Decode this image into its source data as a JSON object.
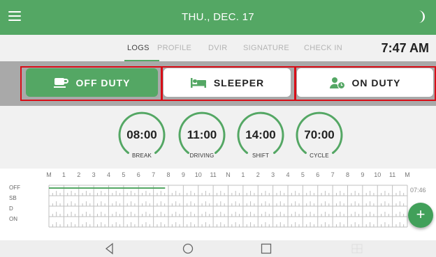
{
  "header": {
    "date": "THU., DEC. 17",
    "menu_icon": "hamburger-menu-icon",
    "theme_icon": "moon-icon"
  },
  "tabs": [
    {
      "label": "LOGS",
      "active": true
    },
    {
      "label": "PROFILE",
      "active": false
    },
    {
      "label": "DVIR",
      "active": false
    },
    {
      "label": "SIGNATURE",
      "active": false
    },
    {
      "label": "CHECK IN",
      "active": false
    }
  ],
  "clock": "7:47 AM",
  "duty_status": {
    "off_duty": {
      "label": "OFF DUTY",
      "icon": "coffee-cup-icon",
      "selected": true
    },
    "sleeper": {
      "label": "SLEEPER",
      "icon": "bed-icon",
      "selected": false
    },
    "on_duty": {
      "label": "ON DUTY",
      "icon": "driver-clock-icon",
      "selected": false
    }
  },
  "timers": [
    {
      "value": "08:00",
      "label": "BREAK"
    },
    {
      "value": "11:00",
      "label": "DRIVING"
    },
    {
      "value": "14:00",
      "label": "SHIFT"
    },
    {
      "value": "70:00",
      "label": "CYCLE"
    }
  ],
  "log_grid": {
    "hours": [
      "M",
      "1",
      "2",
      "3",
      "4",
      "5",
      "6",
      "7",
      "8",
      "9",
      "10",
      "11",
      "N",
      "1",
      "2",
      "3",
      "4",
      "5",
      "6",
      "7",
      "8",
      "9",
      "10",
      "11",
      "M"
    ],
    "rows": [
      "OFF",
      "SB",
      "D",
      "ON"
    ],
    "off_duty_total": "07:46",
    "off_duty_until_hour": 7.78
  },
  "fab": {
    "label": "+"
  },
  "colors": {
    "brand_green": "#54a764",
    "highlight_red": "#d80d17"
  }
}
